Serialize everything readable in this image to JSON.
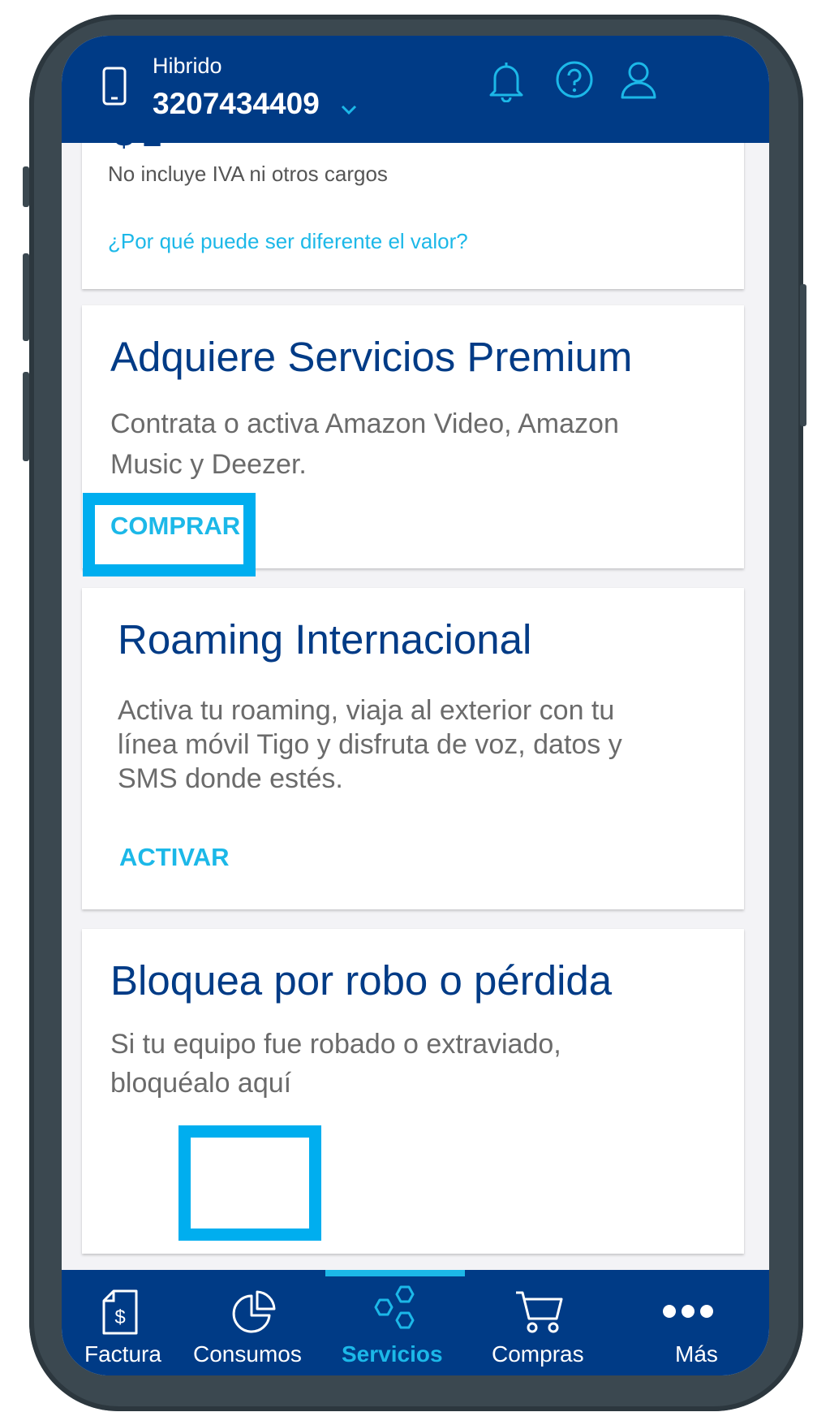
{
  "header": {
    "plan_type": "Hibrido",
    "phone_number": "3207434409",
    "icons": [
      "phone-device-icon",
      "chevron-down-icon",
      "bell-icon",
      "help-icon",
      "user-icon"
    ]
  },
  "balance_card": {
    "note": "No incluye IVA ni otros cargos",
    "link": "¿Por qué puede ser diferente el valor?"
  },
  "cards": [
    {
      "title": "Adquiere Servicios Premium",
      "description": "Contrata o activa Amazon Video, Amazon Music y Deezer.",
      "action": "COMPRAR"
    },
    {
      "title": "Roaming Internacional",
      "description": "Activa tu roaming, viaja al exterior con tu línea móvil Tigo y disfruta de voz, datos y SMS donde estés.",
      "action": "ACTIVAR"
    },
    {
      "title": "Bloquea por robo o pérdida",
      "description": "Si tu equipo fue robado o extraviado, bloquéalo aquí"
    }
  ],
  "bottom_nav": {
    "active": "Servicios",
    "items": [
      {
        "label": "Factura",
        "icon": "invoice-icon"
      },
      {
        "label": "Consumos",
        "icon": "pie-chart-icon"
      },
      {
        "label": "Servicios",
        "icon": "hexagons-icon"
      },
      {
        "label": "Compras",
        "icon": "cart-icon"
      },
      {
        "label": "Más",
        "icon": "more-dots-icon"
      }
    ]
  },
  "colors": {
    "brand_blue": "#003b86",
    "accent_cyan": "#1cb8e8",
    "highlight_box": "#00aeef",
    "phone_frame": "#3b4850"
  }
}
